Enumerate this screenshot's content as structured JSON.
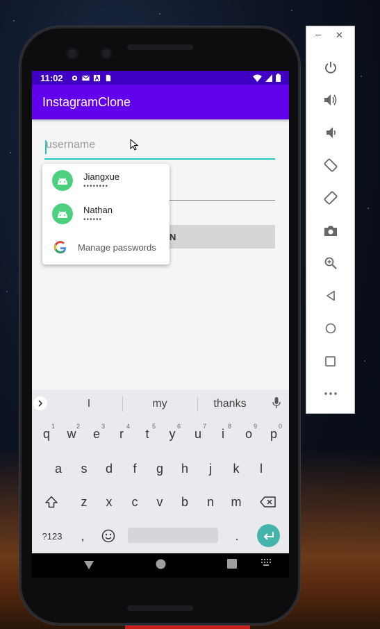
{
  "status_bar": {
    "time": "11:02"
  },
  "app": {
    "title": "InstagramClone"
  },
  "form": {
    "username_placeholder": "username",
    "login_label": "N"
  },
  "autofill": {
    "accounts": [
      {
        "name": "Jiangxue",
        "masked": "••••••••"
      },
      {
        "name": "Nathan",
        "masked": "••••••"
      }
    ],
    "manage_label": "Manage passwords"
  },
  "keyboard": {
    "suggestions": [
      "I",
      "my",
      "thanks"
    ],
    "row1": [
      {
        "k": "q",
        "n": "1"
      },
      {
        "k": "w",
        "n": "2"
      },
      {
        "k": "e",
        "n": "3"
      },
      {
        "k": "r",
        "n": "4"
      },
      {
        "k": "t",
        "n": "5"
      },
      {
        "k": "y",
        "n": "6"
      },
      {
        "k": "u",
        "n": "7"
      },
      {
        "k": "i",
        "n": "8"
      },
      {
        "k": "o",
        "n": "9"
      },
      {
        "k": "p",
        "n": "0"
      }
    ],
    "row2": [
      "a",
      "s",
      "d",
      "f",
      "g",
      "h",
      "j",
      "k",
      "l"
    ],
    "row3": [
      "z",
      "x",
      "c",
      "v",
      "b",
      "n",
      "m"
    ],
    "symbols_label": "?123",
    "comma": ",",
    "period": "."
  },
  "colors": {
    "status_bar": "#3f00c4",
    "app_bar": "#6200ee",
    "accent": "#26c6c1",
    "avatar": "#4cd07d",
    "enter_key": "#45b5ac"
  }
}
